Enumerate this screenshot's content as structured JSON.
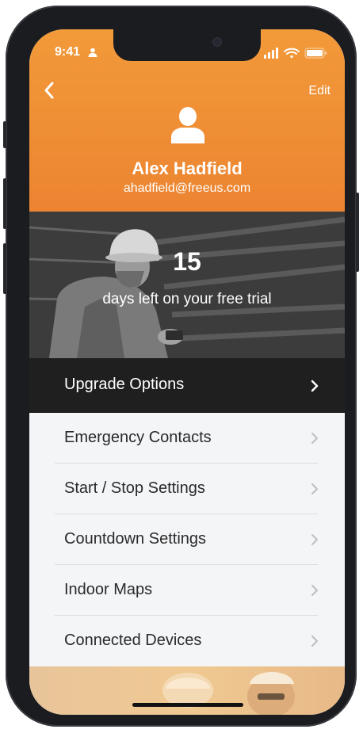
{
  "status_bar": {
    "time": "9:41"
  },
  "header": {
    "edit_label": "Edit",
    "user_name": "Alex Hadfield",
    "user_email": "ahadfield@freeus.com",
    "background_color": "#ec8431"
  },
  "trial_banner": {
    "days_left": "15",
    "message": "days left on your free trial"
  },
  "upgrade": {
    "label": "Upgrade Options"
  },
  "menu": {
    "items": [
      {
        "label": "Emergency Contacts"
      },
      {
        "label": "Start / Stop Settings"
      },
      {
        "label": "Countdown Settings"
      },
      {
        "label": "Indoor Maps"
      },
      {
        "label": "Connected Devices"
      }
    ]
  },
  "icons": {
    "back": "chevron-left-icon",
    "avatar": "person-icon",
    "row_chevron": "chevron-right-icon"
  }
}
